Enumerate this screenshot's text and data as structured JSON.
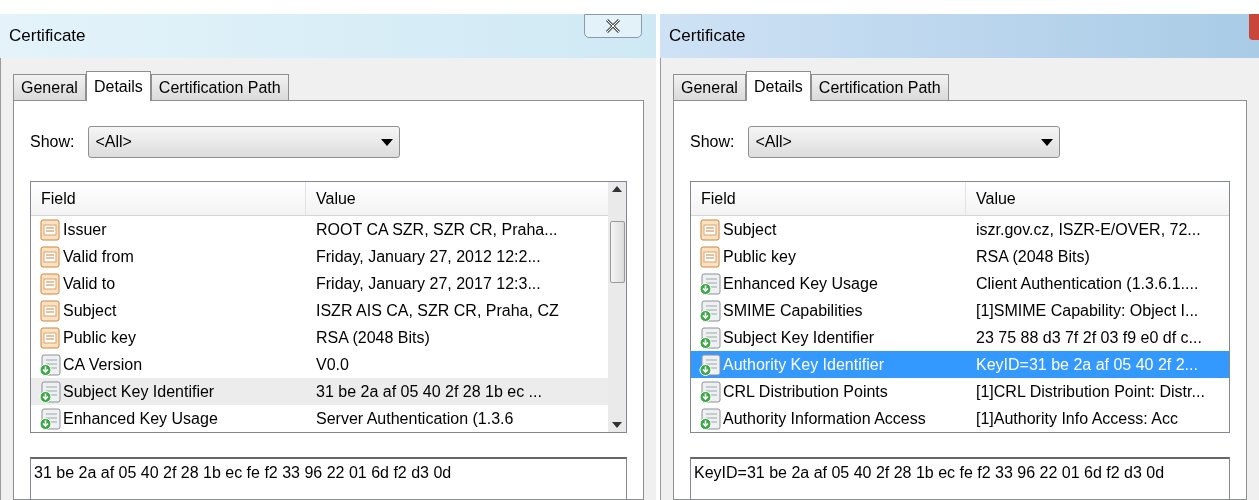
{
  "dialogs": [
    {
      "title": "Certificate",
      "tabs": [
        {
          "label": "General",
          "selected": false
        },
        {
          "label": "Details",
          "selected": true
        },
        {
          "label": "Certification Path",
          "selected": false
        }
      ],
      "show_label": "Show:",
      "show_value": "<All>",
      "list_focused": false,
      "columns": [
        "Field",
        "Value"
      ],
      "rows": [
        {
          "kind": "property",
          "field": "Issuer",
          "value": "ROOT CA SZR, SZR CR, Praha...",
          "selected": false
        },
        {
          "kind": "property",
          "field": "Valid from",
          "value": "Friday, January 27, 2012 12:2...",
          "selected": false
        },
        {
          "kind": "property",
          "field": "Valid to",
          "value": "Friday, January 27, 2017 12:3...",
          "selected": false
        },
        {
          "kind": "property",
          "field": "Subject",
          "value": "ISZR AIS CA, SZR CR, Praha, CZ",
          "selected": false
        },
        {
          "kind": "property",
          "field": "Public key",
          "value": "RSA (2048 Bits)",
          "selected": false
        },
        {
          "kind": "extension",
          "field": "CA Version",
          "value": "V0.0",
          "selected": false
        },
        {
          "kind": "extension",
          "field": "Subject Key Identifier",
          "value": "31 be 2a af 05 40 2f 28 1b ec ...",
          "selected": true
        },
        {
          "kind": "extension",
          "field": "Enhanced Key Usage",
          "value": "Server Authentication (1.3.6",
          "selected": false
        }
      ],
      "detail_text": "31 be 2a af 05 40 2f 28 1b ec fe f2 33 96 22 01 6d f2 d3 0d"
    },
    {
      "title": "Certificate",
      "tabs": [
        {
          "label": "General",
          "selected": false
        },
        {
          "label": "Details",
          "selected": true
        },
        {
          "label": "Certification Path",
          "selected": false
        }
      ],
      "show_label": "Show:",
      "show_value": "<All>",
      "list_focused": true,
      "columns": [
        "Field",
        "Value"
      ],
      "rows": [
        {
          "kind": "property",
          "field": "Subject",
          "value": "iszr.gov.cz, ISZR-E/OVER, 72...",
          "selected": false
        },
        {
          "kind": "property",
          "field": "Public key",
          "value": "RSA (2048 Bits)",
          "selected": false
        },
        {
          "kind": "extension",
          "field": "Enhanced Key Usage",
          "value": "Client Authentication (1.3.6.1....",
          "selected": false
        },
        {
          "kind": "extension",
          "field": "SMIME Capabilities",
          "value": "[1]SMIME Capability: Object I...",
          "selected": false
        },
        {
          "kind": "extension",
          "field": "Subject Key Identifier",
          "value": "23 75 88 d3 7f 2f 03 f9 e0 df c...",
          "selected": false
        },
        {
          "kind": "extension",
          "field": "Authority Key Identifier",
          "value": "KeyID=31 be 2a af 05 40 2f 2...",
          "selected": true
        },
        {
          "kind": "extension",
          "field": "CRL Distribution Points",
          "value": "[1]CRL Distribution Point: Distr...",
          "selected": false
        },
        {
          "kind": "extension",
          "field": "Authority Information Access",
          "value": "[1]Authority Info Access: Acc",
          "selected": false
        }
      ],
      "detail_text": "KeyID=31 be 2a af 05 40 2f 28 1b ec fe f2 33 96 22 01 6d f2 d3 0d"
    }
  ]
}
